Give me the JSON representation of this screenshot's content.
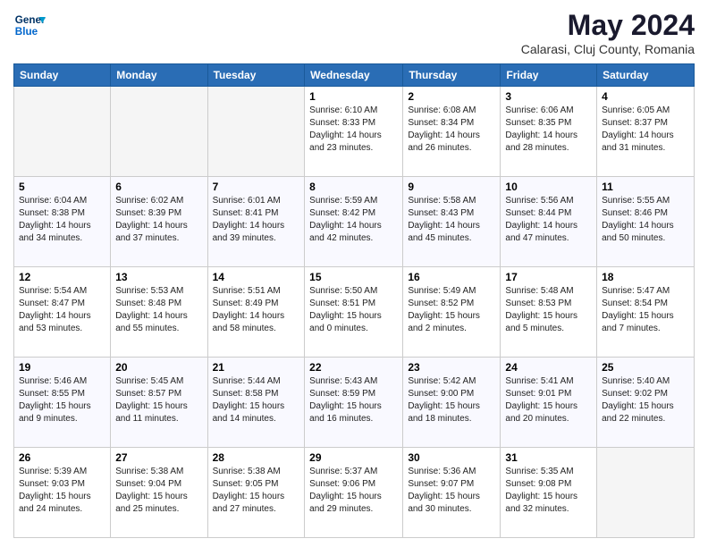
{
  "header": {
    "logo_line1": "General",
    "logo_line2": "Blue",
    "title": "May 2024",
    "location": "Calarasi, Cluj County, Romania"
  },
  "days_of_week": [
    "Sunday",
    "Monday",
    "Tuesday",
    "Wednesday",
    "Thursday",
    "Friday",
    "Saturday"
  ],
  "weeks": [
    [
      {
        "num": "",
        "empty": true
      },
      {
        "num": "",
        "empty": true
      },
      {
        "num": "",
        "empty": true
      },
      {
        "num": "1",
        "sunrise": "6:10 AM",
        "sunset": "8:33 PM",
        "daylight": "14 hours and 23 minutes."
      },
      {
        "num": "2",
        "sunrise": "6:08 AM",
        "sunset": "8:34 PM",
        "daylight": "14 hours and 26 minutes."
      },
      {
        "num": "3",
        "sunrise": "6:06 AM",
        "sunset": "8:35 PM",
        "daylight": "14 hours and 28 minutes."
      },
      {
        "num": "4",
        "sunrise": "6:05 AM",
        "sunset": "8:37 PM",
        "daylight": "14 hours and 31 minutes."
      }
    ],
    [
      {
        "num": "5",
        "sunrise": "6:04 AM",
        "sunset": "8:38 PM",
        "daylight": "14 hours and 34 minutes."
      },
      {
        "num": "6",
        "sunrise": "6:02 AM",
        "sunset": "8:39 PM",
        "daylight": "14 hours and 37 minutes."
      },
      {
        "num": "7",
        "sunrise": "6:01 AM",
        "sunset": "8:41 PM",
        "daylight": "14 hours and 39 minutes."
      },
      {
        "num": "8",
        "sunrise": "5:59 AM",
        "sunset": "8:42 PM",
        "daylight": "14 hours and 42 minutes."
      },
      {
        "num": "9",
        "sunrise": "5:58 AM",
        "sunset": "8:43 PM",
        "daylight": "14 hours and 45 minutes."
      },
      {
        "num": "10",
        "sunrise": "5:56 AM",
        "sunset": "8:44 PM",
        "daylight": "14 hours and 47 minutes."
      },
      {
        "num": "11",
        "sunrise": "5:55 AM",
        "sunset": "8:46 PM",
        "daylight": "14 hours and 50 minutes."
      }
    ],
    [
      {
        "num": "12",
        "sunrise": "5:54 AM",
        "sunset": "8:47 PM",
        "daylight": "14 hours and 53 minutes."
      },
      {
        "num": "13",
        "sunrise": "5:53 AM",
        "sunset": "8:48 PM",
        "daylight": "14 hours and 55 minutes."
      },
      {
        "num": "14",
        "sunrise": "5:51 AM",
        "sunset": "8:49 PM",
        "daylight": "14 hours and 58 minutes."
      },
      {
        "num": "15",
        "sunrise": "5:50 AM",
        "sunset": "8:51 PM",
        "daylight": "15 hours and 0 minutes."
      },
      {
        "num": "16",
        "sunrise": "5:49 AM",
        "sunset": "8:52 PM",
        "daylight": "15 hours and 2 minutes."
      },
      {
        "num": "17",
        "sunrise": "5:48 AM",
        "sunset": "8:53 PM",
        "daylight": "15 hours and 5 minutes."
      },
      {
        "num": "18",
        "sunrise": "5:47 AM",
        "sunset": "8:54 PM",
        "daylight": "15 hours and 7 minutes."
      }
    ],
    [
      {
        "num": "19",
        "sunrise": "5:46 AM",
        "sunset": "8:55 PM",
        "daylight": "15 hours and 9 minutes."
      },
      {
        "num": "20",
        "sunrise": "5:45 AM",
        "sunset": "8:57 PM",
        "daylight": "15 hours and 11 minutes."
      },
      {
        "num": "21",
        "sunrise": "5:44 AM",
        "sunset": "8:58 PM",
        "daylight": "15 hours and 14 minutes."
      },
      {
        "num": "22",
        "sunrise": "5:43 AM",
        "sunset": "8:59 PM",
        "daylight": "15 hours and 16 minutes."
      },
      {
        "num": "23",
        "sunrise": "5:42 AM",
        "sunset": "9:00 PM",
        "daylight": "15 hours and 18 minutes."
      },
      {
        "num": "24",
        "sunrise": "5:41 AM",
        "sunset": "9:01 PM",
        "daylight": "15 hours and 20 minutes."
      },
      {
        "num": "25",
        "sunrise": "5:40 AM",
        "sunset": "9:02 PM",
        "daylight": "15 hours and 22 minutes."
      }
    ],
    [
      {
        "num": "26",
        "sunrise": "5:39 AM",
        "sunset": "9:03 PM",
        "daylight": "15 hours and 24 minutes."
      },
      {
        "num": "27",
        "sunrise": "5:38 AM",
        "sunset": "9:04 PM",
        "daylight": "15 hours and 25 minutes."
      },
      {
        "num": "28",
        "sunrise": "5:38 AM",
        "sunset": "9:05 PM",
        "daylight": "15 hours and 27 minutes."
      },
      {
        "num": "29",
        "sunrise": "5:37 AM",
        "sunset": "9:06 PM",
        "daylight": "15 hours and 29 minutes."
      },
      {
        "num": "30",
        "sunrise": "5:36 AM",
        "sunset": "9:07 PM",
        "daylight": "15 hours and 30 minutes."
      },
      {
        "num": "31",
        "sunrise": "5:35 AM",
        "sunset": "9:08 PM",
        "daylight": "15 hours and 32 minutes."
      },
      {
        "num": "",
        "empty": true
      }
    ]
  ]
}
